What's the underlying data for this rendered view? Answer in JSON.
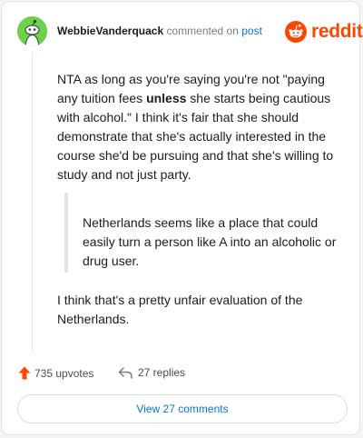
{
  "header": {
    "username": "WebbieVanderquack",
    "action_text": "commented on",
    "post_link": "post"
  },
  "brand": {
    "logo_text": "reddit",
    "logo_icon": "reddit-alien-icon",
    "accent_color": "#ff4500"
  },
  "avatar": {
    "icon": "snoo-avatar-icon",
    "background_color": "#6bd24a"
  },
  "comment": {
    "para1_before": "NTA as long as you're saying you're not \"paying any tuition fees ",
    "para1_bold": "unless",
    "para1_after": " she starts being cautious with alcohol.\" I think it's fair that she should demonstrate that she's actually interested in the course she'd be pursuing and that she's willing to study and not just party.",
    "quote": "Netherlands seems like a place that could easily turn a person like A into an alcoholic or drug user.",
    "para2": "I think that's a pretty unfair evaluation of the Netherlands."
  },
  "footer": {
    "upvote_icon": "upvote-arrow-icon",
    "upvotes_label": "735 upvotes",
    "reply_icon": "reply-icon",
    "replies_label": "27 replies"
  },
  "view_button_label": "View 27 comments"
}
